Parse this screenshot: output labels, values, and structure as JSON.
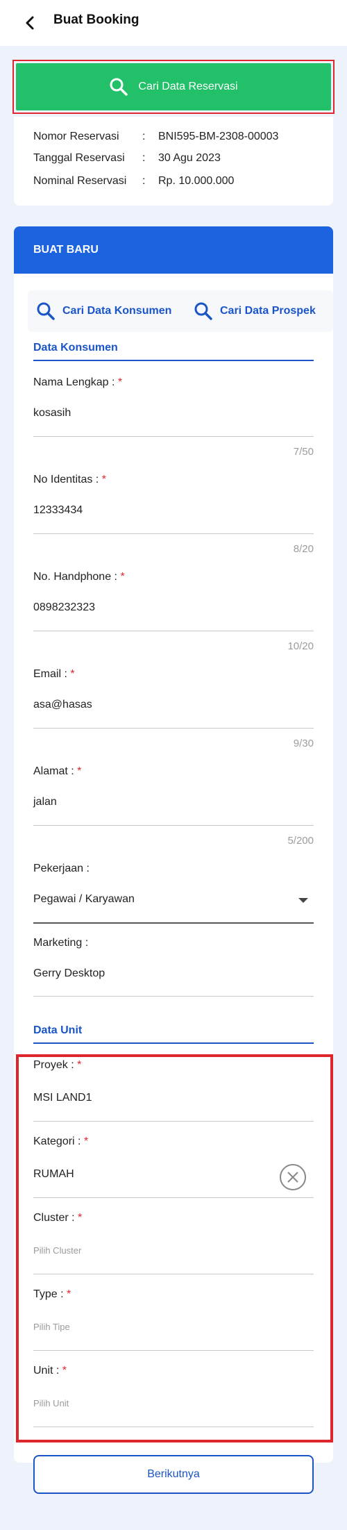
{
  "header": {
    "title": "Buat Booking",
    "back_icon": "chevron-left-icon"
  },
  "search_reservation": {
    "label": "Cari Data Reservasi",
    "icon": "search-icon",
    "color": "#22c069"
  },
  "reservation": {
    "rows": [
      {
        "label": "Nomor Reservasi",
        "sep": ":",
        "value": "BNI595-BM-2308-00003"
      },
      {
        "label": "Tanggal Reservasi",
        "sep": ":",
        "value": "30 Agu 2023"
      },
      {
        "label": "Nominal Reservasi",
        "sep": ":",
        "value": "Rp. 10.000.000"
      }
    ]
  },
  "form": {
    "header": "BUAT BARU",
    "header_color": "#1c63e0",
    "lookups": {
      "konsumen": "Cari Data Konsumen",
      "prospek": "Cari Data Prospek"
    },
    "konsumen_section": "Data Konsumen",
    "fields": {
      "nama": {
        "label": "Nama Lengkap :",
        "required": "*",
        "value": "kosasih",
        "counter": "7/50"
      },
      "identitas": {
        "label": "No Identitas :",
        "required": "*",
        "value": "12333434",
        "counter": "8/20"
      },
      "handphone": {
        "label": "No. Handphone :",
        "required": "*",
        "value": "0898232323",
        "counter": "10/20"
      },
      "email": {
        "label": "Email :",
        "required": "*",
        "value": "asa@hasas",
        "counter": "9/30"
      },
      "alamat": {
        "label": "Alamat :",
        "required": "*",
        "value": "jalan",
        "counter": "5/200"
      },
      "pekerjaan": {
        "label": "Pekerjaan :",
        "value": "Pegawai / Karyawan"
      },
      "marketing": {
        "label": "Marketing :",
        "value": "Gerry Desktop"
      }
    },
    "unit_section": "Data Unit",
    "unit_fields": {
      "proyek": {
        "label": "Proyek :",
        "required": "*",
        "value": "MSI LAND1"
      },
      "kategori": {
        "label": "Kategori :",
        "required": "*",
        "value": "RUMAH"
      },
      "cluster": {
        "label": "Cluster :",
        "required": "*",
        "placeholder": "Pilih Cluster"
      },
      "type": {
        "label": "Type :",
        "required": "*",
        "placeholder": "Pilih Tipe"
      },
      "unit": {
        "label": "Unit :",
        "required": "*",
        "placeholder": "Pilih Unit"
      }
    }
  },
  "next_button": "Berikutnya"
}
